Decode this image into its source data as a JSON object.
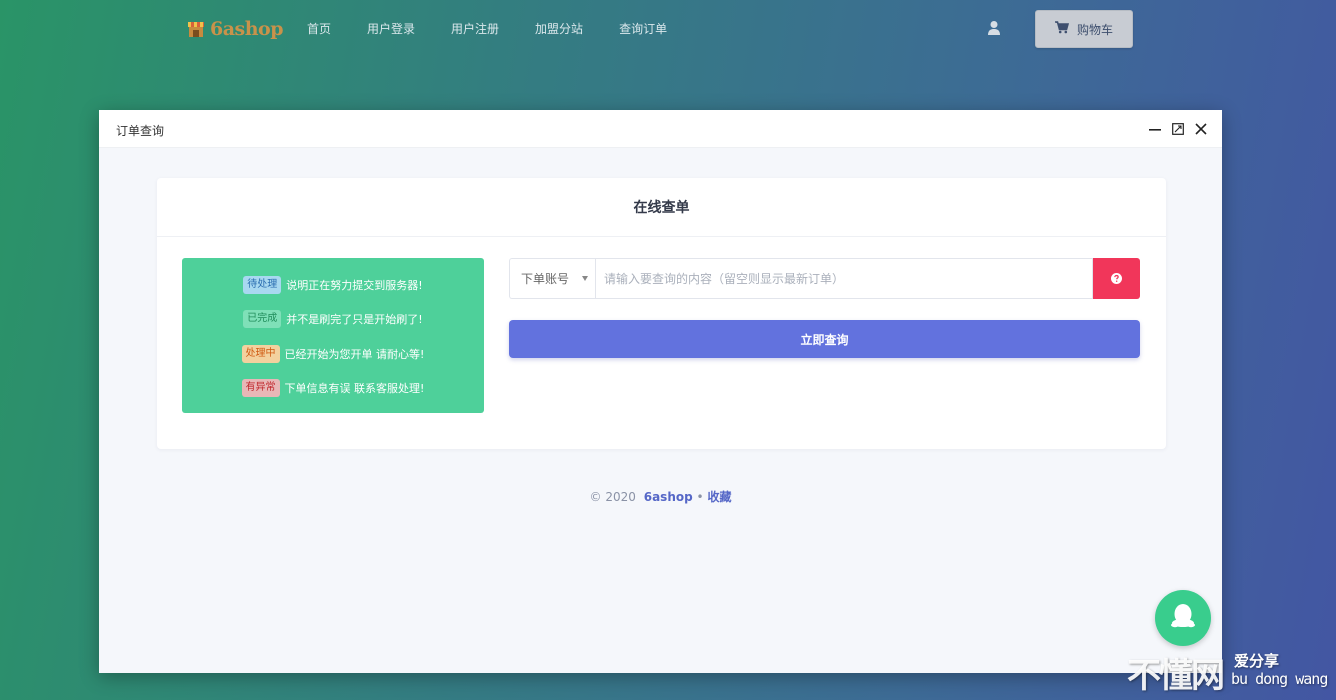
{
  "brand": {
    "name": "6ashop"
  },
  "nav": {
    "items": [
      "首页",
      "用户登录",
      "用户注册",
      "加盟分站",
      "查询订单"
    ]
  },
  "header": {
    "user_icon": "user-icon",
    "cart_label": "购物车",
    "cart_icon": "cart-icon"
  },
  "modal": {
    "title": "订单查询",
    "controls": [
      "minimize-icon",
      "maximize-icon",
      "close-icon"
    ]
  },
  "card": {
    "title": "在线查单"
  },
  "statuses": [
    {
      "badge": "待处理",
      "text": "说明正在努力提交到服务器!",
      "kind": "pending"
    },
    {
      "badge": "已完成",
      "text": "并不是刷完了只是开始刷了!",
      "kind": "done"
    },
    {
      "badge": "处理中",
      "text": "已经开始为您开单 请耐心等!",
      "kind": "proc"
    },
    {
      "badge": "有异常",
      "text": "下单信息有误 联系客服处理!",
      "kind": "err"
    }
  ],
  "query": {
    "select_value": "下单账号",
    "input_value": "",
    "input_placeholder": "请输入要查询的内容（留空则显示最新订单）",
    "help_icon": "question-circle-icon",
    "submit_label": "立即查询"
  },
  "footer": {
    "copyright": "© 2020",
    "brand": "6ashop",
    "separator": "•",
    "favorite": "收藏"
  },
  "chat": {
    "icon": "qq-penguin-icon"
  },
  "watermark": {
    "big": "不懂网",
    "cn": "爱分享",
    "en": "bu dong wang"
  },
  "colors": {
    "status_panel": "#4ed09a",
    "submit": "#6272de",
    "help": "#f1365a",
    "chat": "#39cd8d"
  }
}
